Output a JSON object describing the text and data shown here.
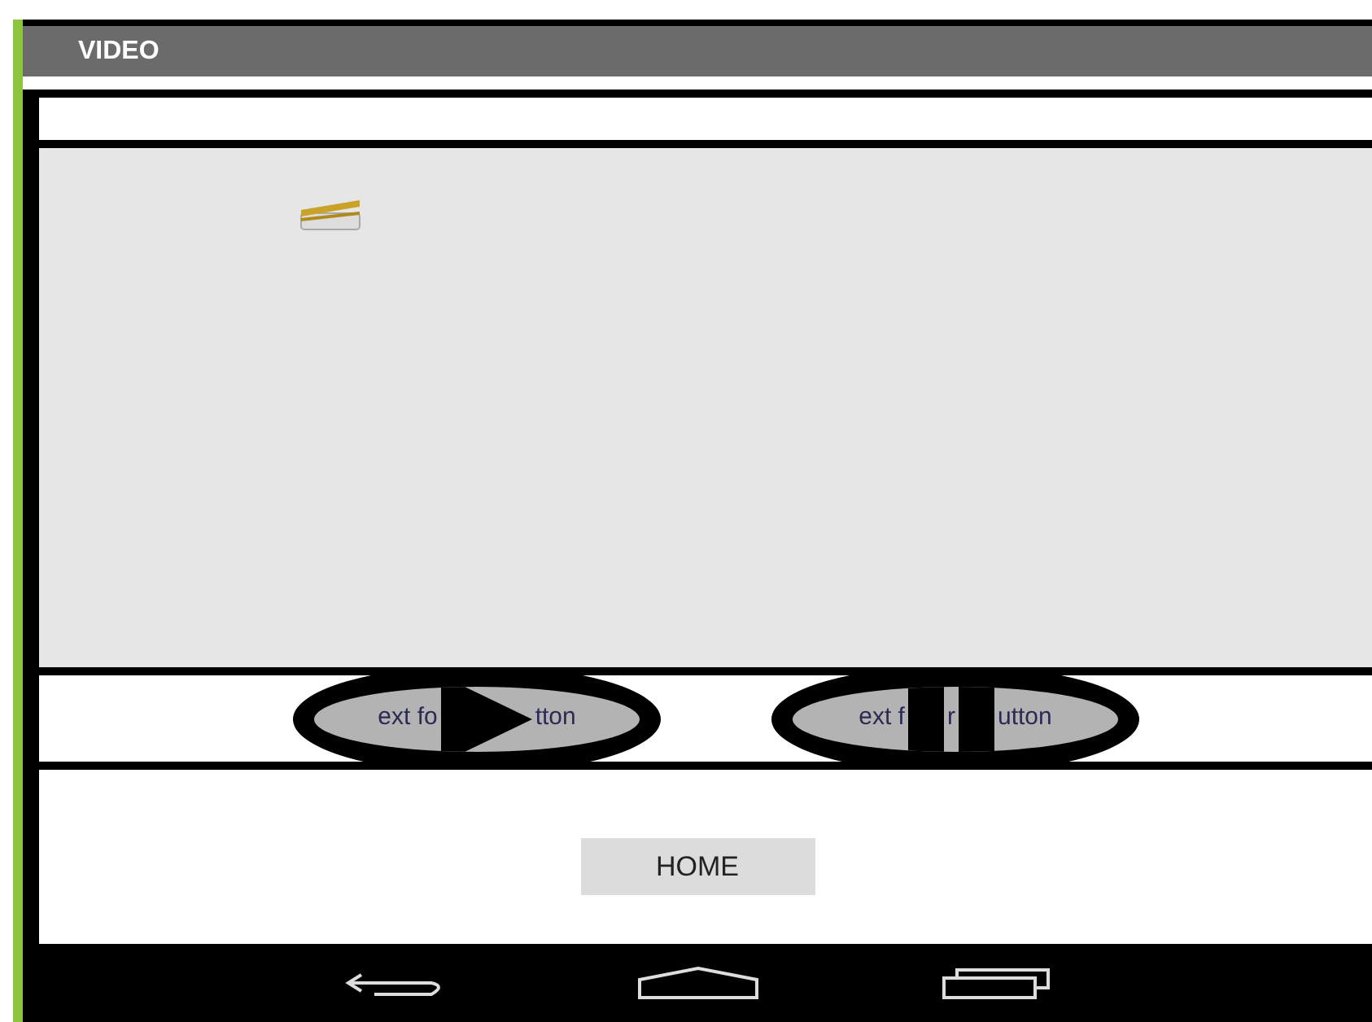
{
  "title_bar": {
    "title": "VIDEO"
  },
  "media_buttons": [
    {
      "kind": "play",
      "label_parts": [
        "ext fo",
        "tton"
      ]
    },
    {
      "kind": "pause",
      "label_parts": [
        "ext f",
        "r",
        "utton"
      ]
    }
  ],
  "home_button": {
    "label": "HOME"
  }
}
